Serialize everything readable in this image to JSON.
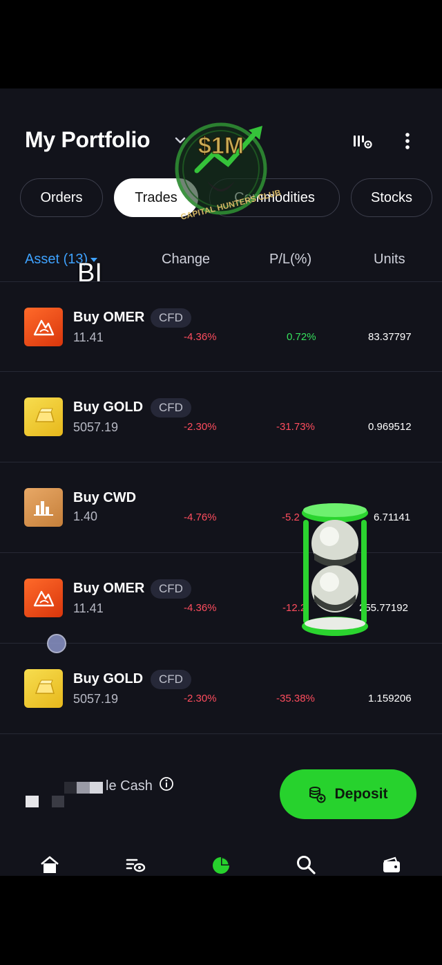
{
  "header": {
    "title": "My Portfolio"
  },
  "tabs": [
    {
      "label": "Orders",
      "active": false
    },
    {
      "label": "Trades",
      "active": true
    },
    {
      "label": "Commodities",
      "active": false
    },
    {
      "label": "Stocks",
      "active": false
    }
  ],
  "columns": {
    "asset": "Asset (13)",
    "change": "Change",
    "pl": "P/L(%)",
    "units": "Units"
  },
  "overlay_text": "BI",
  "watermark": {
    "amount": "$1M",
    "brand": "CAPITAL HUNTERS CLUB"
  },
  "rows": [
    {
      "name": "Buy OMER",
      "badge": "CFD",
      "price": "11.41",
      "change": "-4.36%",
      "pl": "0.72%",
      "pl_sign": "pos",
      "units": "83.37797",
      "icon": "omer-logo-icon"
    },
    {
      "name": "Buy GOLD",
      "badge": "CFD",
      "price": "5057.19",
      "change": "-2.30%",
      "pl": "-31.73%",
      "pl_sign": "neg",
      "units": "0.969512",
      "icon": "gold-bar-icon"
    },
    {
      "name": "Buy CWD",
      "badge": "",
      "price": "1.40",
      "change": "-4.76%",
      "pl": "-5.2",
      "pl_sign": "neg",
      "units": "6.71141",
      "icon": "cwd-logo-icon"
    },
    {
      "name": "Buy OMER",
      "badge": "CFD",
      "price": "11.41",
      "change": "-4.36%",
      "pl": "-12.2",
      "pl_sign": "neg",
      "units": "255.77192",
      "icon": "omer-logo-icon"
    },
    {
      "name": "Buy GOLD",
      "badge": "CFD",
      "price": "5057.19",
      "change": "-2.30%",
      "pl": "-35.38%",
      "pl_sign": "neg",
      "units": "1.159206",
      "icon": "gold-bar-icon"
    }
  ],
  "footer": {
    "cash_label": "le Cash",
    "deposit_label": "Deposit"
  },
  "nav": [
    "home-icon",
    "watchlist-icon",
    "portfolio-icon",
    "search-icon",
    "wallet-icon"
  ],
  "colors": {
    "accent_green": "#27d22d",
    "negative": "#ff4d5e",
    "positive": "#35e05c",
    "link_blue": "#3ea2ff"
  }
}
